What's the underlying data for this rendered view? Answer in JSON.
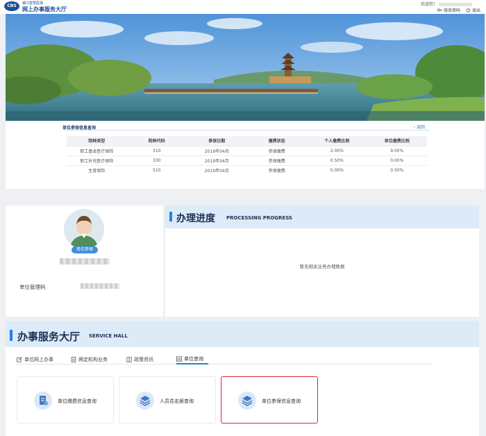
{
  "header": {
    "logo_text": "CBS",
    "brand_sub": "镇江智慧医保",
    "brand_title": "网上办事服务大厅",
    "welcome": "欢迎您！",
    "change_password": "修改密码",
    "logout": "退出"
  },
  "query": {
    "title": "单位参保信息查询",
    "back": "返回",
    "columns": [
      "险种类型",
      "险种代码",
      "参保日期",
      "缴费状态",
      "个人缴费比例",
      "单位缴费比例"
    ],
    "rows": [
      [
        "职工基本医疗保险",
        "310",
        "2019年04月",
        "参保缴费",
        "2.00%",
        "9.00%"
      ],
      [
        "职工补充医疗保险",
        "330",
        "2019年04月",
        "参保缴费",
        "0.50%",
        "0.00%"
      ],
      [
        "生育保险",
        "510",
        "2019年04月",
        "参保缴费",
        "0.00%",
        "0.50%"
      ]
    ]
  },
  "profile": {
    "badge": "单位参保",
    "manager_label": "单位管理码"
  },
  "progress": {
    "title": "办理进度",
    "title_en": "PROCESSING PROGRESS",
    "empty": "暂无相关业务办理数据"
  },
  "hall": {
    "title": "办事服务大厅",
    "title_en": "SERVICE HALL",
    "tabs": [
      {
        "label": "单位网上办事",
        "icon": "edit-icon"
      },
      {
        "label": "两定机构业务",
        "icon": "document-icon"
      },
      {
        "label": "政策资讯",
        "icon": "book-icon"
      },
      {
        "label": "单位查询",
        "icon": "list-icon",
        "active": true
      }
    ],
    "cards": [
      {
        "label": "单位缴费信息查询",
        "icon": "payment-doc-icon"
      },
      {
        "label": "人员花名册查询",
        "icon": "stack-search-icon"
      },
      {
        "label": "单位参保信息查询",
        "icon": "stack-search-icon",
        "selected": true
      }
    ]
  },
  "colors": {
    "brand": "#1c4f96",
    "accent": "#2a7de1",
    "highlight": "#d8262a",
    "panel_head": "#ddebf8"
  }
}
